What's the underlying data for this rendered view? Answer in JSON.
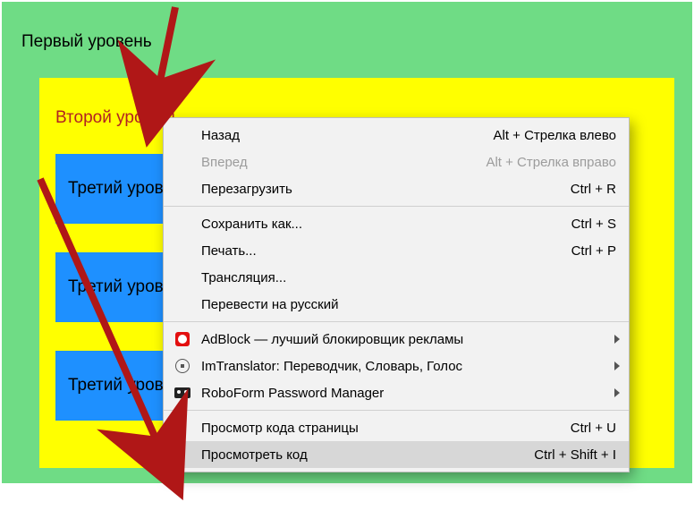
{
  "levels": {
    "l1": "Первый уровень",
    "l2": "Второй уровень",
    "l3a": "Третий уровень",
    "l3b": "Третий уровень",
    "l3c": "Третий уровень"
  },
  "menu": {
    "back": {
      "label": "Назад",
      "shortcut": "Alt + Стрелка влево"
    },
    "forward": {
      "label": "Вперед",
      "shortcut": "Alt + Стрелка вправо"
    },
    "reload": {
      "label": "Перезагрузить",
      "shortcut": "Ctrl + R"
    },
    "saveas": {
      "label": "Сохранить как...",
      "shortcut": "Ctrl + S"
    },
    "print": {
      "label": "Печать...",
      "shortcut": "Ctrl + P"
    },
    "cast": {
      "label": "Трансляция..."
    },
    "translate": {
      "label": "Перевести на русский"
    },
    "adblock": {
      "label": "AdBlock — лучший блокировщик рекламы"
    },
    "imtrans": {
      "label": "ImTranslator: Переводчик, Словарь, Голос"
    },
    "robo": {
      "label": "RoboForm Password Manager"
    },
    "viewssrc": {
      "label": "Просмотр кода страницы",
      "shortcut": "Ctrl + U"
    },
    "inspect": {
      "label": "Просмотреть код",
      "shortcut": "Ctrl + Shift + I"
    }
  },
  "arrow_color": "#b01717"
}
